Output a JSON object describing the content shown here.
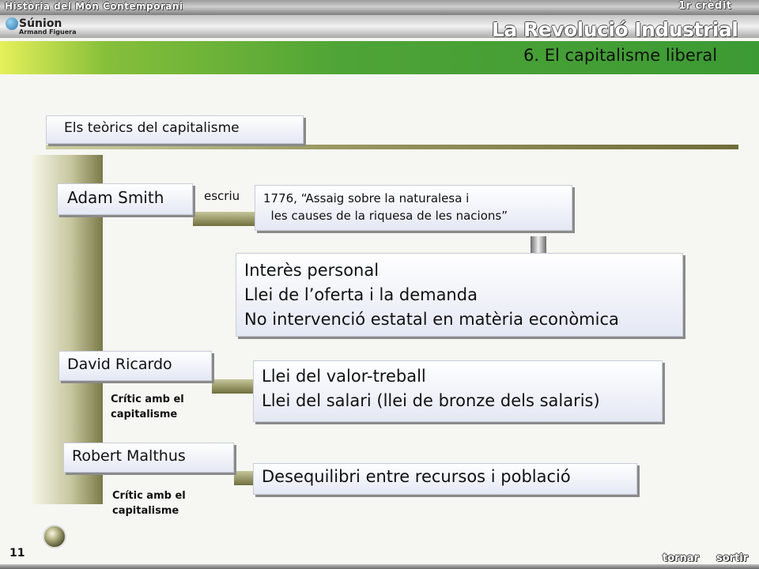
{
  "header": {
    "course": "Història del Món Contemporani",
    "credit": "1r crèdit",
    "logo_name": "Súnion",
    "author": "Armand Figuera",
    "unit_title": "La Revolució Industrial",
    "section_title": "6. El capitalisme liberal"
  },
  "content": {
    "heading": "Els teòrics del capitalisme",
    "smith": {
      "name": "Adam Smith",
      "verb": "escriu",
      "book_lines": [
        "1776, “Assaig sobre la naturalesa i",
        "  les causes de la riquesa de les nacions”"
      ],
      "ideas": [
        "Interès personal",
        "Llei de l’oferta i la demanda",
        "No intervenció estatal en matèria econòmica"
      ]
    },
    "ricardo": {
      "name": "David Ricardo",
      "critic": [
        "Crític amb el",
        "capitalisme"
      ],
      "ideas": [
        "Llei del valor-treball",
        "Llei del salari (llei de bronze dels salaris)"
      ]
    },
    "malthus": {
      "name": "Robert Malthus",
      "critic": [
        "Crític amb el",
        "capitalisme"
      ],
      "ideas": [
        "Desequilibri entre recursos i població"
      ]
    }
  },
  "footer": {
    "page_number": "11",
    "back_label": "tornar",
    "exit_label": "sortir"
  },
  "colors": {
    "green_bar": "#4ea436",
    "box_fill": "#e4e8f4",
    "stem": "#7a7a48"
  }
}
